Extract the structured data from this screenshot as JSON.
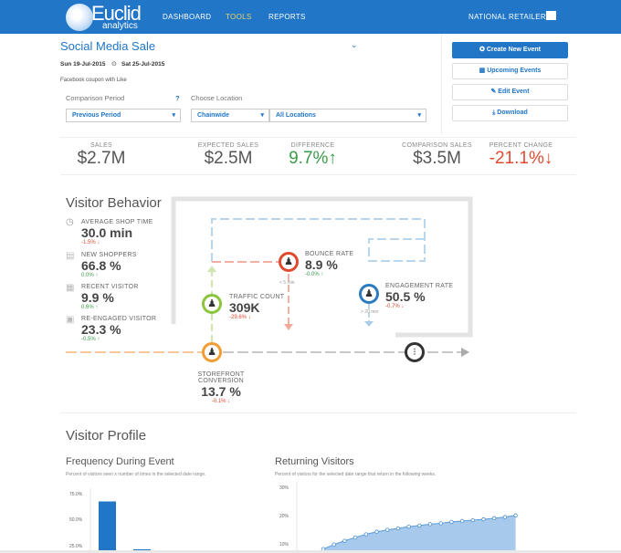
{
  "header": {
    "logo_main": "Euclid",
    "logo_sub": "analytics",
    "nav": [
      "DASHBOARD",
      "TOOLS",
      "REPORTS"
    ],
    "active_nav": "TOOLS",
    "account": "NATIONAL RETAILER"
  },
  "event": {
    "title": "Social Media Sale",
    "start": "Sun 19-Jul-2015",
    "end": "Sat 25-Jul-2015",
    "description": "Facebook coupon with Like",
    "comparison_label": "Comparison Period",
    "help": "?",
    "comparison_value": "Previous Period",
    "location_label": "Choose Location",
    "location_scope": "Chainwide",
    "location_value": "All Locations"
  },
  "actions": {
    "create": "Create New Event",
    "upcoming": "Upcoming Events",
    "edit": "Edit Event",
    "download": "Download"
  },
  "kpis": [
    {
      "label": "SALES",
      "value": "$2.7M"
    },
    {
      "label": "EXPECTED SALES",
      "value": "$2.5M"
    },
    {
      "label": "DIFFERENCE",
      "value": "9.7%",
      "arrow": "↑"
    },
    {
      "label": "COMPARISON SALES",
      "value": "$3.5M"
    },
    {
      "label": "PERCENT CHANGE",
      "value": "-21.1%",
      "arrow": "↓"
    }
  ],
  "visitor_behavior": {
    "title": "Visitor Behavior",
    "metrics": [
      {
        "label": "AVERAGE SHOP TIME",
        "value": "30.0 min",
        "delta": "-1.5% ↓"
      },
      {
        "label": "NEW SHOPPERS",
        "value": "66.8 %",
        "delta": "0.0% ↑"
      },
      {
        "label": "RECENT VISITOR",
        "value": "9.9 %",
        "delta": "0.6% ↑"
      },
      {
        "label": "RE-ENGAGED VISITOR",
        "value": "23.3 %",
        "delta": "-0.5% ↑"
      }
    ],
    "traffic": {
      "label": "TRAFFIC COUNT",
      "value": "309K",
      "delta": "-29.6% ↓"
    },
    "bounce": {
      "label": "BOUNCE RATE",
      "value": "8.9 %",
      "delta": "-0.0% ↑",
      "note": "< 5 min"
    },
    "engagement": {
      "label": "ENGAGEMENT RATE",
      "value": "50.5 %",
      "delta": "-0.7% ↓",
      "note": "> 20 min"
    },
    "storefront": {
      "label": "STOREFRONT CONVERSION",
      "value": "13.7 %",
      "delta": "-0.1% ↓"
    }
  },
  "visitor_profile": {
    "title": "Visitor Profile"
  },
  "colors": {
    "brand": "#2176c7",
    "up": "#3a9b4a",
    "down": "#e04a2f"
  },
  "chart_data": [
    {
      "type": "bar",
      "title": "Frequency During Event",
      "subtitle": "Percent of visitors seen x number of times in the selected date range.",
      "yticks": [
        "75.0%",
        "50.0%",
        "25.0%"
      ],
      "values": [
        68,
        22
      ],
      "ylim": [
        0,
        75
      ]
    },
    {
      "type": "area",
      "title": "Returning Visitors",
      "subtitle": "Percent of visitors for the selected date range that return in the following weeks.",
      "yticks": [
        "30%",
        "20%",
        "10%"
      ],
      "values": [
        8.5,
        10.1,
        11.4,
        12.6,
        13.7,
        14.6,
        15.3,
        15.8,
        16.4,
        16.8,
        17.3,
        17.6,
        18.1,
        18.4,
        18.7,
        19.0,
        19.4,
        19.8,
        20.4
      ],
      "ylim": [
        0,
        30
      ]
    }
  ]
}
